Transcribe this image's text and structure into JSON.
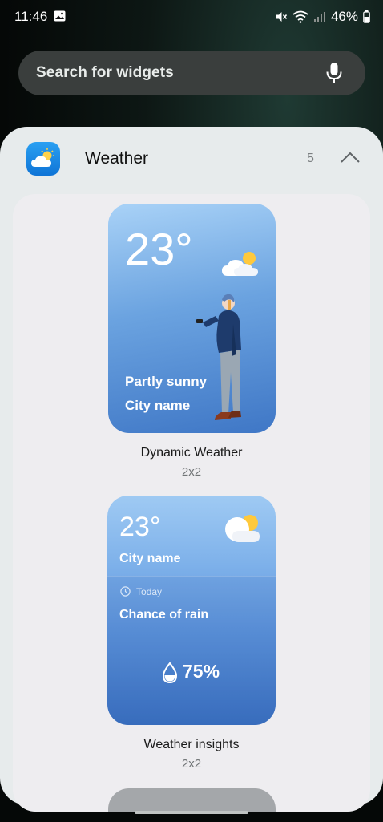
{
  "status": {
    "time": "11:46",
    "battery": "46%"
  },
  "search": {
    "placeholder": "Search for widgets"
  },
  "app": {
    "title": "Weather",
    "count": "5"
  },
  "widgets": [
    {
      "name": "Dynamic Weather",
      "size": "2x2",
      "temp": "23°",
      "condition": "Partly sunny",
      "city": "City name"
    },
    {
      "name": "Weather insights",
      "size": "2x2",
      "temp": "23°",
      "city": "City name",
      "today": "Today",
      "chance": "Chance of rain",
      "percent": "75%"
    }
  ],
  "colors": {
    "accent": "#1a88e6",
    "sheet": "#e7ebec",
    "widget_blue": "#5d93da"
  },
  "icons": [
    "image-icon",
    "mute-icon",
    "wifi-icon",
    "signal-icon",
    "battery-icon",
    "mic-icon",
    "weather-app-icon",
    "chevron-up-icon",
    "cloud-sun-icon",
    "clock-icon",
    "water-drop-icon"
  ]
}
